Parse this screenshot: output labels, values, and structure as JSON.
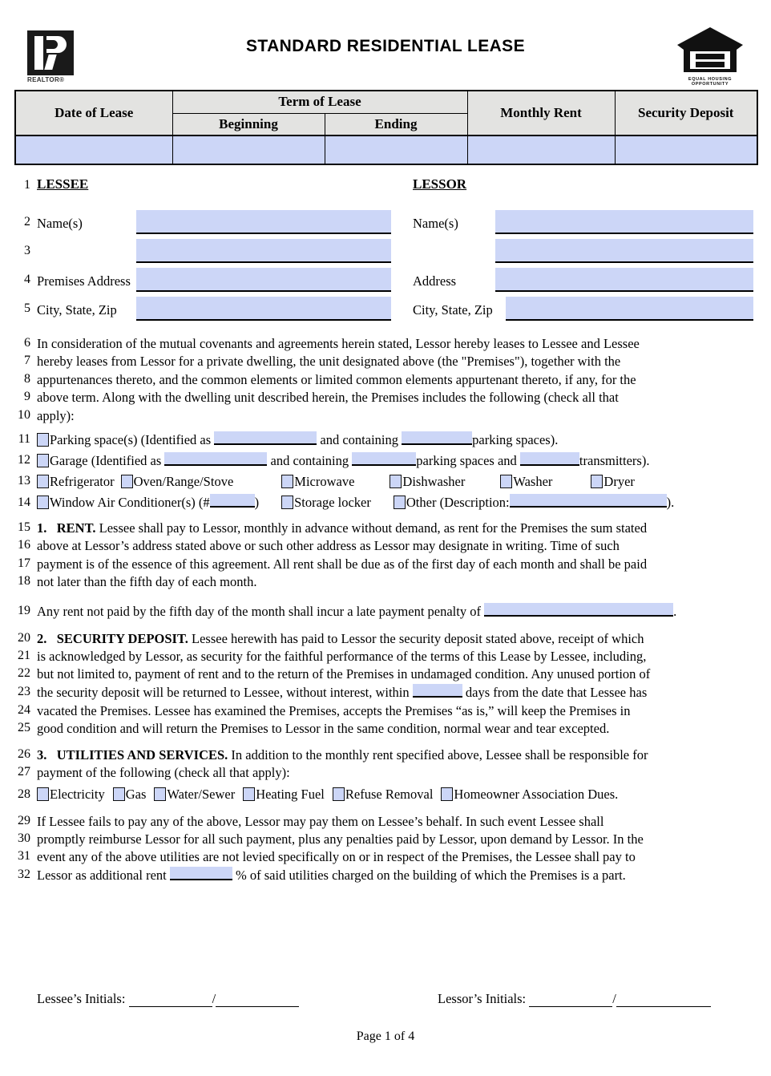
{
  "document": {
    "title": "STANDARD RESIDENTIAL LEASE",
    "page_label": "Page 1 of 4",
    "realtor_logo_text": "REALTOR®",
    "equal_housing_logo_text": "EQUAL HOUSING OPPORTUNITY"
  },
  "lease_table": {
    "headers": {
      "date_of_lease": "Date of Lease",
      "term_of_lease": "Term of Lease",
      "beginning": "Beginning",
      "ending": "Ending",
      "monthly_rent": "Monthly Rent",
      "security_deposit": "Security Deposit"
    },
    "values": {
      "date_of_lease": "",
      "beginning": "",
      "ending": "",
      "monthly_rent": "",
      "security_deposit": ""
    }
  },
  "parties": {
    "lessee_heading": "LESSEE",
    "lessor_heading": "LESSOR",
    "lessee_labels": {
      "names": "Name(s)",
      "names2": "",
      "premises_address": "Premises Address",
      "city_state_zip": "City, State, Zip"
    },
    "lessor_labels": {
      "names": "Name(s)",
      "names2": "",
      "address": "Address",
      "city_state_zip": "City, State, Zip"
    },
    "values": {
      "lessee_names": "",
      "lessee_names2": "",
      "lessee_premises_address": "",
      "lessee_city_state_zip": "",
      "lessor_names": "",
      "lessor_names2": "",
      "lessor_address": "",
      "lessor_city_state_zip": ""
    }
  },
  "line_numbers": [
    "1",
    "2",
    "3",
    "4",
    "5",
    "6",
    "7",
    "8",
    "9",
    "10",
    "11",
    "12",
    "13",
    "14",
    "15",
    "16",
    "17",
    "18",
    "19",
    "20",
    "21",
    "22",
    "23",
    "24",
    "25",
    "26",
    "27",
    "28",
    "29",
    "30",
    "31",
    "32"
  ],
  "intro": {
    "l6": "In consideration of the mutual covenants and agreements herein stated, Lessor hereby leases to Lessee and Lessee",
    "l7": "hereby leases from Lessor for a private dwelling, the unit designated above (the \"Premises\"), together with the",
    "l8": "appurtenances thereto, and the common elements or limited common elements appurtenant thereto, if any, for the",
    "l9": "above term. Along with the dwelling unit described herein, the Premises includes the following (check all that",
    "l10": "apply):"
  },
  "inclusions": {
    "parking": {
      "pre": "Parking space(s) (Identified as",
      "mid": "and containing",
      "post": "parking spaces).",
      "identified_value": "",
      "count_value": ""
    },
    "garage": {
      "pre": "Garage (Identified as",
      "mid": "and containing",
      "mid2": "parking spaces and",
      "post": "transmitters).",
      "identified_value": "",
      "spaces_value": "",
      "transmitters_value": ""
    },
    "appliances": [
      {
        "label": "Refrigerator",
        "checked": false
      },
      {
        "label": "Oven/Range/Stove",
        "checked": false
      },
      {
        "label": "Microwave",
        "checked": false
      },
      {
        "label": "Dishwasher",
        "checked": false
      },
      {
        "label": "Washer",
        "checked": false
      },
      {
        "label": "Dryer",
        "checked": false
      }
    ],
    "row14": {
      "wac_pre": "Window Air Conditioner(s) (#",
      "wac_post": ")",
      "wac_value": "",
      "storage_locker": "Storage locker",
      "other_pre": "Other (Description:",
      "other_post": ").",
      "other_value": ""
    }
  },
  "section1": {
    "number": "1.",
    "heading": "RENT.",
    "l15": "Lessee shall pay to Lessor, monthly in advance without demand, as rent for the Premises the sum stated",
    "l16": "above at Lessor’s address stated above or such other address as Lessor may designate in writing. Time of such",
    "l17": "payment is of the essence of this agreement. All rent shall be due as of the first day of each month and shall be paid",
    "l18": "not later than the fifth day of each month.",
    "l19_pre": "Any rent not paid by the fifth day of the month shall incur a late payment penalty of",
    "l19_post": ".",
    "late_penalty_value": ""
  },
  "section2": {
    "number": "2.",
    "heading": "SECURITY DEPOSIT.",
    "l20": "Lessee herewith has paid to Lessor the security deposit stated above, receipt of which",
    "l21": "is acknowledged by Lessor, as security for the faithful performance of the terms of this Lease by Lessee, including,",
    "l22": "but not limited to, payment of rent and to the return of the Premises in undamaged condition. Any unused portion of",
    "l23_pre": "the security deposit will be returned to Lessee, without interest, within",
    "l23_post": "days from the date that Lessee has",
    "days_value": "",
    "l24": "vacated the Premises. Lessee has examined the Premises, accepts the Premises “as is,” will keep the Premises in",
    "l25": "good condition and will return the Premises to Lessor in the same condition, normal wear and tear excepted."
  },
  "section3": {
    "number": "3.",
    "heading": "UTILITIES AND SERVICES.",
    "l26": "In addition to the monthly rent specified above, Lessee shall be responsible for",
    "l27": "payment of the following (check all that apply):",
    "utilities": [
      {
        "label": "Electricity",
        "checked": false
      },
      {
        "label": "Gas",
        "checked": false
      },
      {
        "label": "Water/Sewer",
        "checked": false
      },
      {
        "label": "Heating Fuel",
        "checked": false
      },
      {
        "label": "Refuse Removal",
        "checked": false
      },
      {
        "label": "Homeowner Association Dues.",
        "checked": false
      }
    ],
    "l29": "If Lessee fails to pay any of the above, Lessor may pay them on Lessee’s behalf. In such event Lessee shall",
    "l30": "promptly reimburse Lessor for all such payment, plus any penalties paid by Lessor, upon demand by Lessor. In the",
    "l31": "event any of the above utilities are not levied specifically on or in respect of the Premises, the Lessee shall pay to",
    "l32_pre": "Lessor as additional rent",
    "l32_post": "% of said utilities charged on the building of which the Premises is a part.",
    "percent_value": ""
  },
  "footer": {
    "lessee_initials_label": "Lessee’s Initials:",
    "lessor_initials_label": "Lessor’s Initials:",
    "separator": "/",
    "lessee_initial_1": "",
    "lessee_initial_2": "",
    "lessor_initial_1": "",
    "lessor_initial_2": ""
  },
  "colors": {
    "form_field": "#ccd6f7",
    "table_header": "#e3e3e1",
    "text": "#000000"
  }
}
